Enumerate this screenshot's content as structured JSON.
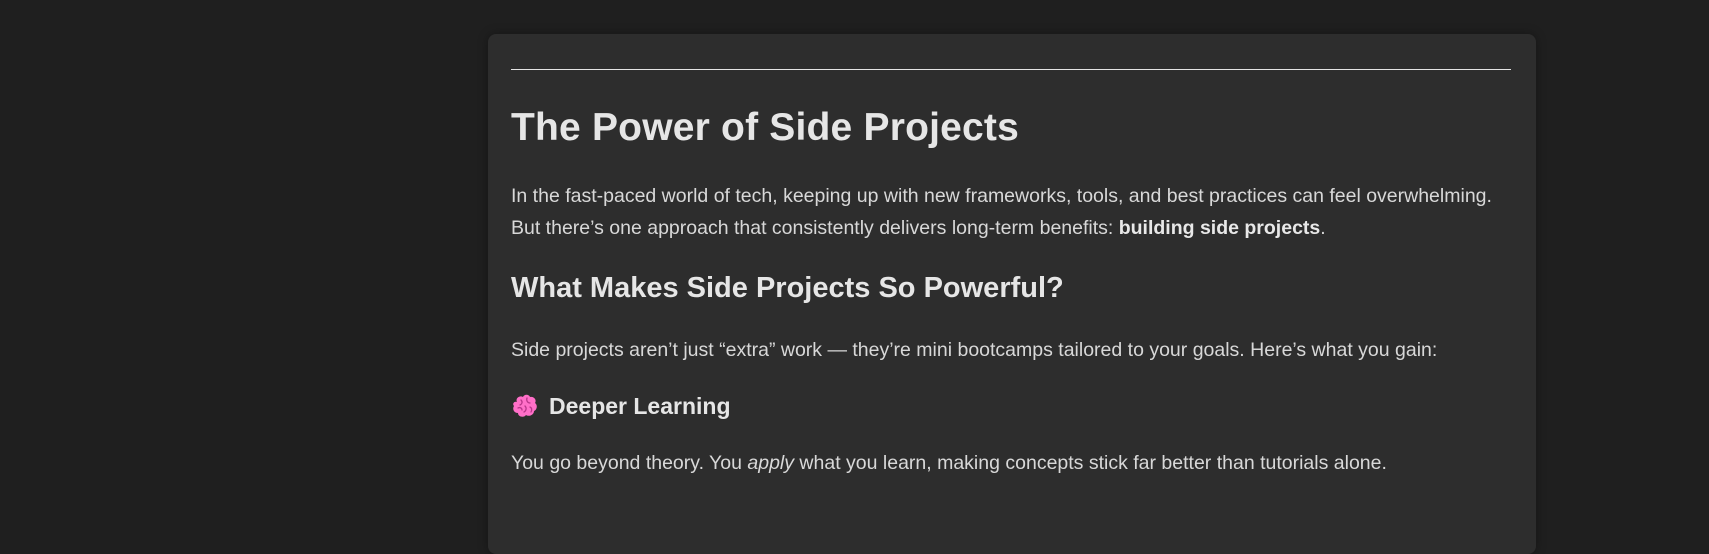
{
  "article": {
    "title": "The Power of Side Projects",
    "intro": {
      "text": "In the fast-paced world of tech, keeping up with new frameworks, tools, and best practices can feel overwhelming. But there’s one approach that consistently delivers long-term benefits: ",
      "emphasis": "building side projects",
      "end": "."
    },
    "section_heading": "What Makes Side Projects So Powerful?",
    "section_lead": "Side projects aren’t just “extra” work — they’re mini bootcamps tailored to your goals. Here’s what you gain:",
    "benefit": {
      "icon": "brain-icon",
      "heading": "Deeper Learning",
      "text_before": "You go beyond theory. You ",
      "italic": "apply",
      "text_after": " what you learn, making concepts stick far better than tutorials alone."
    }
  },
  "colors": {
    "background": "#1f1f1f",
    "card": "#2d2d2d",
    "text": "#d8d8d8",
    "heading": "#e6e6e6",
    "brain": "#ff6fc8"
  }
}
